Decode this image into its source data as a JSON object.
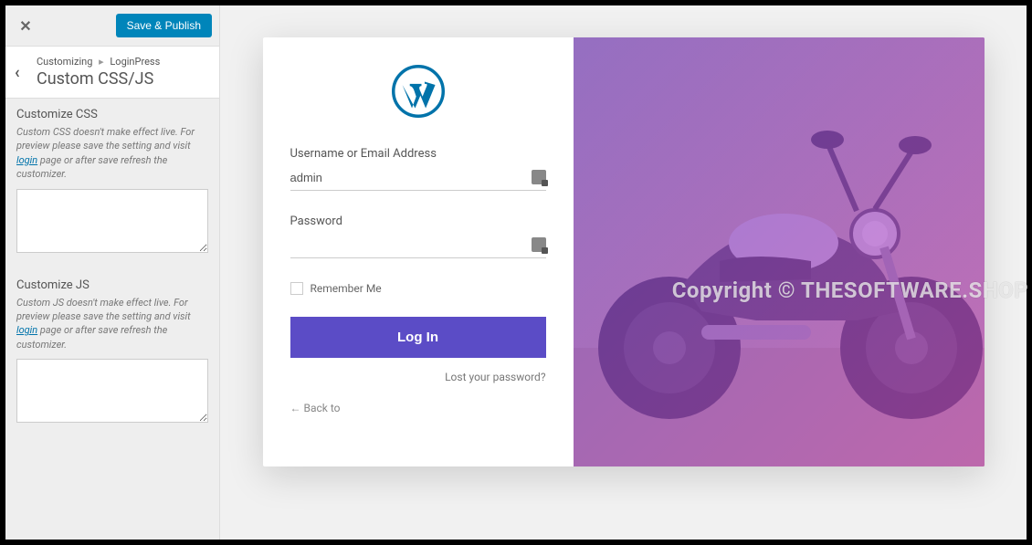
{
  "sidebar": {
    "close_icon": "✕",
    "save_publish": "Save & Publish",
    "breadcrumb_prefix": "Customizing",
    "breadcrumb_sep": "▸",
    "breadcrumb_parent": "LoginPress",
    "panel_title": "Custom CSS/JS",
    "back_arrow": "‹",
    "css": {
      "label": "Customize CSS",
      "desc_prefix": "Custom CSS doesn't make effect live. For preview please save the setting and visit ",
      "desc_link": "login",
      "desc_suffix": " page or after save refresh the customizer."
    },
    "js": {
      "label": "Customize JS",
      "desc_prefix": "Custom JS doesn't make effect live. For preview please save the setting and visit ",
      "desc_link": "login",
      "desc_suffix": " page or after save refresh the customizer."
    }
  },
  "login": {
    "username_label": "Username or Email Address",
    "username_value": "admin",
    "password_label": "Password",
    "password_value": "",
    "remember_label": "Remember Me",
    "login_button": "Log In",
    "lost_password": "Lost your password?",
    "back_to": "← Back to"
  },
  "watermark": "Copyright © THESOFTWARE.SHOP"
}
